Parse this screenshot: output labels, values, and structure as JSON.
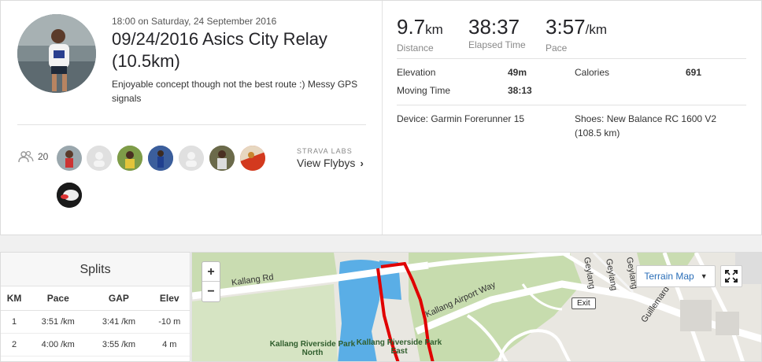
{
  "activity": {
    "timestamp": "18:00 on Saturday, 24 September 2016",
    "title": "09/24/2016 Asics City Relay (10.5km)",
    "description": "Enjoyable concept though not the best route :) Messy GPS signals",
    "kudos_count": "20",
    "flyby_lab": "STRAVA LABS",
    "flyby_link": "View Flybys",
    "flyby_chevron": "›"
  },
  "stats": {
    "distance": {
      "value": "9.7",
      "unit": "km",
      "label": "Distance"
    },
    "elapsed": {
      "value": "38:37",
      "label": "Elapsed Time"
    },
    "pace": {
      "value": "3:57",
      "unit": "/km",
      "label": "Pace"
    },
    "elevation_label": "Elevation",
    "elevation_value": "49m",
    "calories_label": "Calories",
    "calories_value": "691",
    "moving_label": "Moving Time",
    "moving_value": "38:13",
    "device": "Device: Garmin Forerunner 15",
    "shoes": "Shoes: New Balance RC 1600 V2 (108.5 km)"
  },
  "splits": {
    "title": "Splits",
    "headers": [
      "KM",
      "Pace",
      "GAP",
      "Elev"
    ],
    "rows": [
      [
        "1",
        "3:51 /km",
        "3:41 /km",
        "-10 m"
      ],
      [
        "2",
        "4:00 /km",
        "3:55 /km",
        "4 m"
      ]
    ]
  },
  "map": {
    "zoom_in": "+",
    "zoom_out": "−",
    "terrain_label": "Terrain Map",
    "terrain_caret": "▼",
    "roads": {
      "kallang_rd": "Kallang Rd",
      "airport_way": "Kallang Airport Way",
      "geylang1": "Geylang",
      "geylang2": "Geylang",
      "geylang3": "Geylang",
      "guillemard": "Guillemard"
    },
    "exit": "Exit",
    "park_north": "Kallang Riverside Park North",
    "park_east": "Kallang Riverside Park East",
    "route_color": "#e00000",
    "accent": "#2a6eb8"
  }
}
